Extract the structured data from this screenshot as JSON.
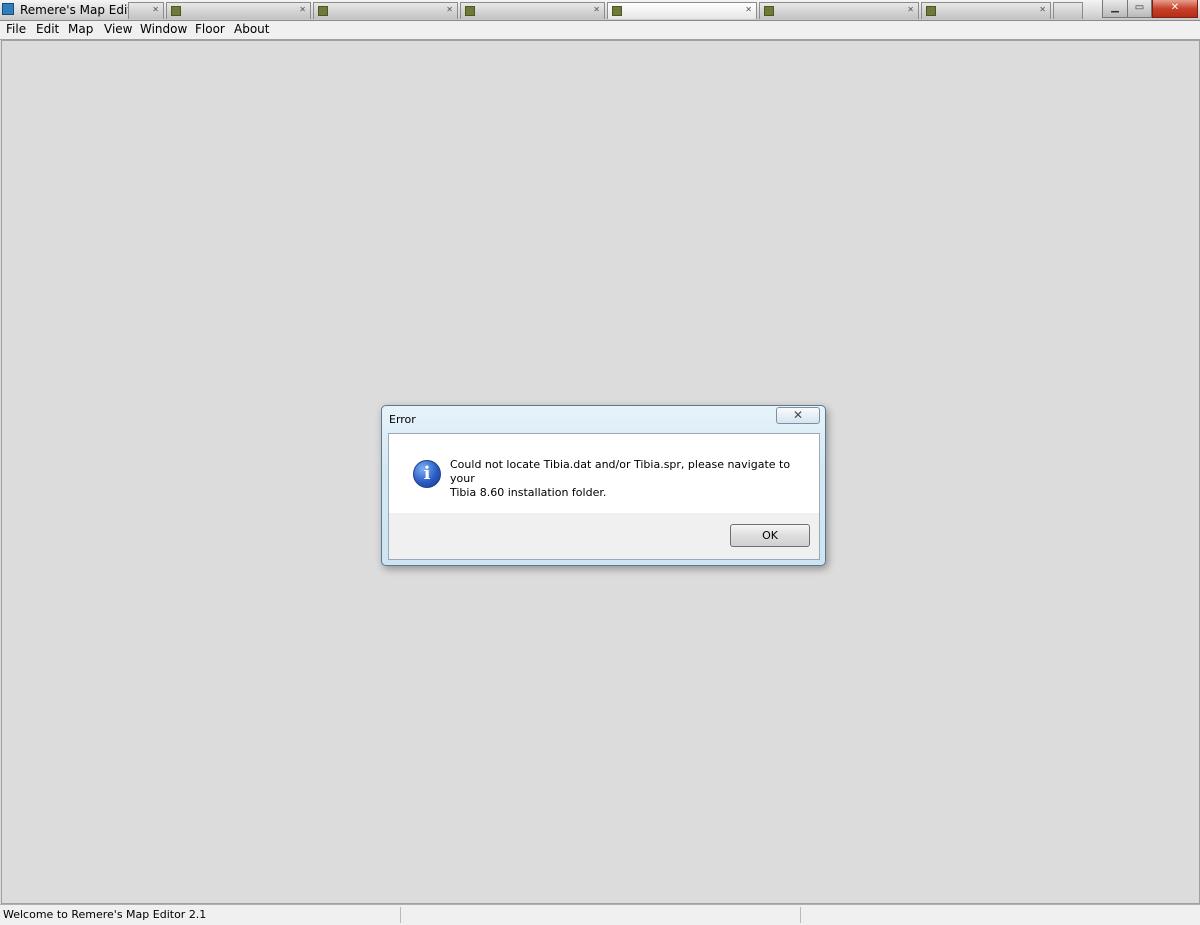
{
  "window": {
    "title": "Remere's Map Editor"
  },
  "background_tabs": [
    {
      "label": ""
    },
    {
      "label": ""
    },
    {
      "label": ""
    },
    {
      "label": ""
    },
    {
      "label": ""
    },
    {
      "label": ""
    },
    {
      "label": ""
    },
    {
      "label": ""
    },
    {
      "label": ""
    }
  ],
  "window_controls": {
    "minimize": "▁",
    "maximize": "▭",
    "close": "✕"
  },
  "menu": {
    "items": [
      {
        "label": "File"
      },
      {
        "label": "Edit"
      },
      {
        "label": "Map"
      },
      {
        "label": "View"
      },
      {
        "label": "Window"
      },
      {
        "label": "Floor"
      },
      {
        "label": "About"
      }
    ]
  },
  "dialog": {
    "title": "Error",
    "close_glyph": "✕",
    "icon": "information-icon",
    "icon_glyph": "i",
    "message_line1": "Could not locate Tibia.dat and/or Tibia.spr, please navigate to your",
    "message_line2": "Tibia 8.60 installation folder.",
    "ok_label": "OK"
  },
  "status": {
    "text": "Welcome to Remere's Map Editor 2.1"
  },
  "colors": {
    "workspace": "#dcdcdc",
    "dialog_frame": "#cfe4f2",
    "info_icon": "#2a5cc4"
  }
}
